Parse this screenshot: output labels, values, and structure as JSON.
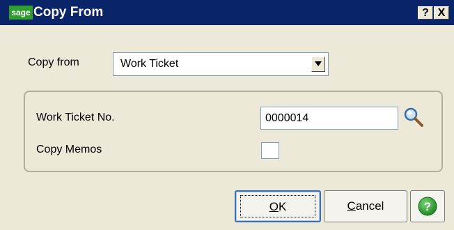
{
  "window": {
    "title": "Copy From",
    "logo": "sage",
    "help_button": "?",
    "close_button": "X"
  },
  "copy_from": {
    "label": "Copy from",
    "selected": "Work Ticket"
  },
  "group": {
    "work_ticket_label": "Work Ticket No.",
    "work_ticket_value": "0000014",
    "copy_memos_label": "Copy Memos",
    "copy_memos_checked": false
  },
  "buttons": {
    "ok_mnemonic": "O",
    "ok_rest": "K",
    "cancel_mnemonic": "C",
    "cancel_rest": "ancel"
  },
  "colors": {
    "titlebar": "#0A246A",
    "face": "#ECE9D8",
    "help_green": "#2E9E2E"
  },
  "icons": [
    "magnifier-icon",
    "help-circle-icon",
    "dropdown-arrow-icon"
  ]
}
